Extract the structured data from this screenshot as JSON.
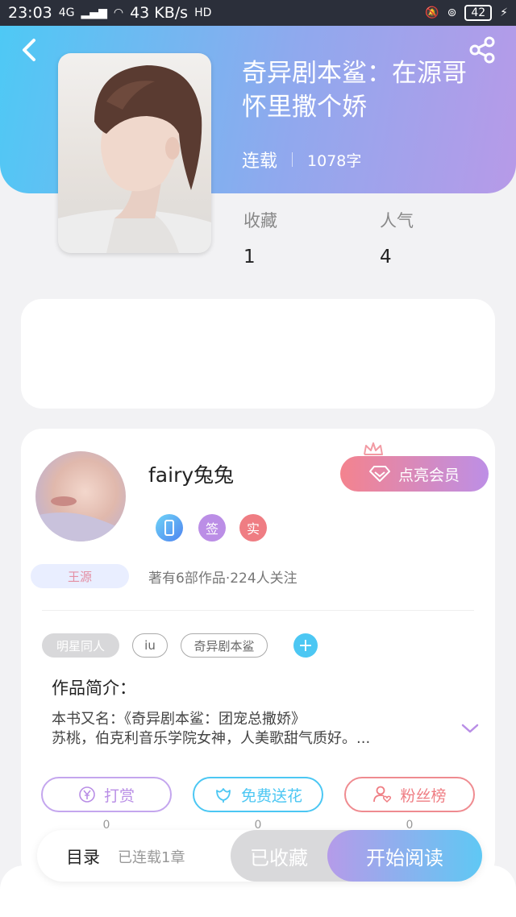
{
  "status_bar": {
    "time": "23:03",
    "network": "4G",
    "speed": "43 KB/s",
    "hd": "HD",
    "battery": "42"
  },
  "book": {
    "title": "奇异剧本鲨：在源哥怀里撒个娇",
    "status": "连载",
    "word_count": "1078字",
    "stats": [
      {
        "label": "收藏",
        "value": "1"
      },
      {
        "label": "人气",
        "value": "4"
      }
    ]
  },
  "author": {
    "name": "fairy兔兔",
    "vip_label": "点亮会员",
    "badges": [
      "签",
      "实"
    ],
    "fan_tag": "王源",
    "works_line": "著有6部作品·224人关注"
  },
  "tags": [
    "明星同人",
    "iu",
    "奇异剧本鲨",
    "+"
  ],
  "intro": {
    "title": "作品简介：",
    "line1": "本书又名：《奇异剧本鲨：团宠总撒娇》",
    "line2": "苏桃，伯克利音乐学院女神，人美歌甜气质好。..."
  },
  "actions": [
    {
      "label": "打赏",
      "count": "0",
      "icon": "yen-icon",
      "color": "#b98ee6"
    },
    {
      "label": "免费送花",
      "count": "0",
      "icon": "flower-icon",
      "color": "#4cc7f3"
    },
    {
      "label": "粉丝榜",
      "count": "0",
      "icon": "user-heart-icon",
      "color": "#ef7d83"
    }
  ],
  "bottom_bar": {
    "toc_label": "目录",
    "toc_status": "已连载1章",
    "collected_label": "已收藏",
    "read_label": "开始阅读"
  },
  "colors": {
    "header_gradient_start": "#4ec9f5",
    "header_gradient_end": "#b79ae8",
    "accent_blue": "#4cc7f3",
    "accent_purple": "#b98ee6",
    "accent_red": "#ef7d83"
  }
}
